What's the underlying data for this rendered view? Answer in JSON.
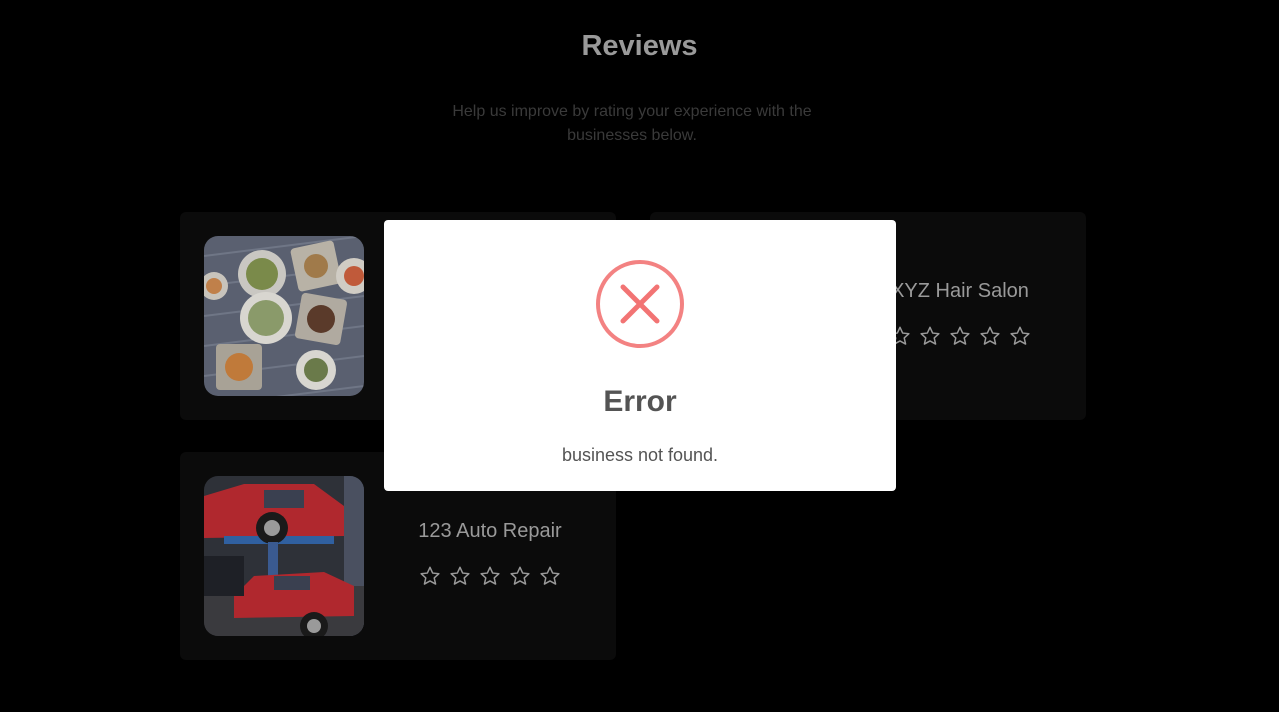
{
  "header": {
    "title": "Reviews",
    "subtitle": "Help us improve by rating your experience with the businesses below."
  },
  "businesses": [
    {
      "name": "",
      "photo": "restaurant-food-photo",
      "rating": 0,
      "max_rating": 5
    },
    {
      "name": "XYZ Hair Salon",
      "photo": "hair-salon-photo",
      "rating": 0,
      "max_rating": 5
    },
    {
      "name": "123 Auto Repair",
      "photo": "auto-repair-garage-photo",
      "rating": 0,
      "max_rating": 5
    }
  ],
  "modal": {
    "icon": "error-x-icon",
    "title": "Error",
    "message": "business not found."
  },
  "colors": {
    "background": "#000000",
    "card": "#0b0b0b",
    "text_muted": "#9a9a9a",
    "error_red": "#f27474",
    "modal_text": "#545454"
  }
}
